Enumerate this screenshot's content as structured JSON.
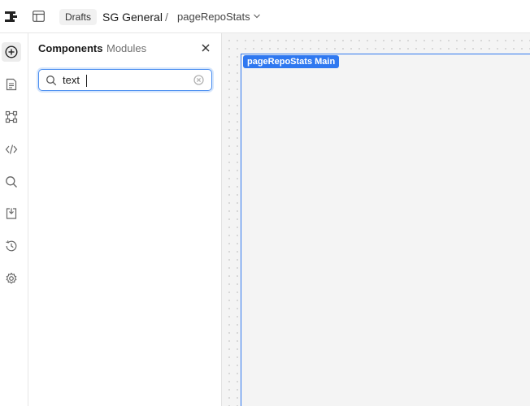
{
  "header": {
    "drafts_label": "Drafts",
    "project_name": "SG General",
    "separator": "/",
    "page_name": "pageRepoStats"
  },
  "rail": {
    "items": [
      {
        "icon": "plus-circle-icon",
        "active": true
      },
      {
        "icon": "document-icon"
      },
      {
        "icon": "nodes-icon"
      },
      {
        "icon": "code-icon"
      },
      {
        "icon": "search-icon"
      },
      {
        "icon": "import-icon"
      },
      {
        "icon": "history-icon"
      },
      {
        "icon": "gear-icon"
      }
    ]
  },
  "panel": {
    "tabs": [
      {
        "label": "Components",
        "active": true
      },
      {
        "label": "Modules",
        "active": false
      }
    ],
    "search": {
      "value": "text",
      "placeholder": ""
    }
  },
  "canvas": {
    "frame_label": "pageRepoStats Main"
  },
  "colors": {
    "accent": "#2f78f0",
    "canvas_bg": "#f4f4f4"
  }
}
